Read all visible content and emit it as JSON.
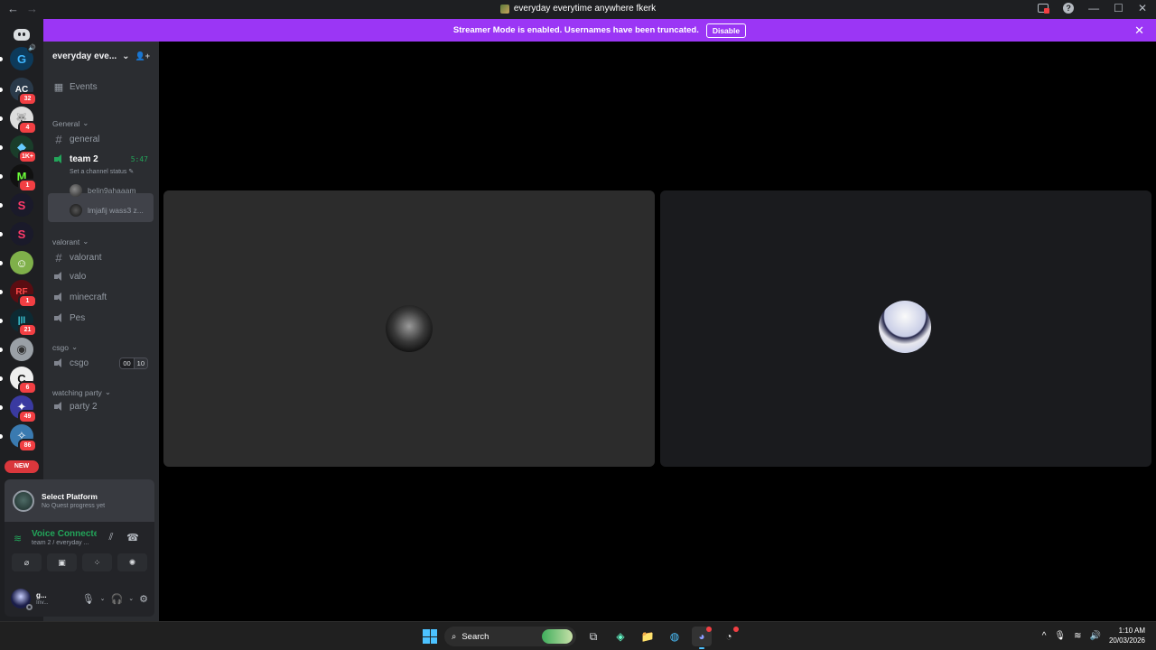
{
  "window": {
    "title": "everyday everytime anywhere fkerk",
    "back_glyph": "←",
    "forward_glyph": "→",
    "help_glyph": "?",
    "minimize_glyph": "—",
    "maximize_glyph": "☐",
    "close_glyph": "✕"
  },
  "banner": {
    "text": "Streamer Mode is enabled. Usernames have been truncated.",
    "button": "Disable",
    "close_glyph": "✕",
    "color": "#9b36f5"
  },
  "guilds": [
    {
      "name": "guild-g",
      "letter": "G",
      "bg": "#0d3a5a",
      "fg": "#3fb6ff",
      "badge": null,
      "speaker": true
    },
    {
      "name": "guild-ac",
      "letter": "AC",
      "bg": "#2a3a4a",
      "fg": "#fff",
      "badge": "32",
      "speaker": false
    },
    {
      "name": "guild-wolf",
      "letter": "🐺",
      "bg": "#ddd",
      "fg": "#222",
      "badge": "4",
      "speaker": false
    },
    {
      "name": "guild-dark",
      "letter": "◆",
      "bg": "#1a3d2a",
      "fg": "#6cf",
      "badge": "1K+",
      "speaker": false
    },
    {
      "name": "guild-m",
      "letter": "M",
      "bg": "#111",
      "fg": "#6cff3a",
      "badge": "1",
      "speaker": false
    },
    {
      "name": "guild-s1",
      "letter": "S",
      "bg": "#1a1a2a",
      "fg": "#ff3a6a",
      "badge": null,
      "speaker": false
    },
    {
      "name": "guild-s2",
      "letter": "S",
      "bg": "#1a1a2a",
      "fg": "#ff3a6a",
      "badge": null,
      "speaker": false
    },
    {
      "name": "guild-face",
      "letter": "☺",
      "bg": "#7fb04a",
      "fg": "#fff",
      "badge": null,
      "speaker": false
    },
    {
      "name": "guild-red",
      "letter": "RF",
      "bg": "#5a0d12",
      "fg": "#ff4a4a",
      "badge": "1",
      "speaker": false
    },
    {
      "name": "guild-teal",
      "letter": "|||",
      "bg": "#0d2a33",
      "fg": "#3fd6e6",
      "badge": "21",
      "speaker": false
    },
    {
      "name": "guild-gray",
      "letter": "◉",
      "bg": "#9aa0a6",
      "fg": "#333",
      "badge": null,
      "speaker": false
    },
    {
      "name": "guild-white",
      "letter": "C",
      "bg": "#eee",
      "fg": "#111",
      "badge": "6",
      "speaker": false
    },
    {
      "name": "guild-anime",
      "letter": "✦",
      "bg": "#3a3aa0",
      "fg": "#fff",
      "badge": "49",
      "speaker": false
    },
    {
      "name": "guild-blue",
      "letter": "✧",
      "bg": "#3a7ab0",
      "fg": "#fff",
      "badge": "86",
      "speaker": false
    }
  ],
  "new_badge": "NEW",
  "server": {
    "name": "everyday eve...",
    "chevron": "⌄",
    "invite_glyph": "👤+",
    "events_label": "Events",
    "categories": [
      {
        "label": "General",
        "chevron": "⌄"
      },
      {
        "label": "valorant",
        "chevron": "⌄"
      },
      {
        "label": "csgo",
        "chevron": "⌄"
      },
      {
        "label": "watching party",
        "chevron": "⌄"
      }
    ],
    "channels": {
      "general": "general",
      "team2": "team 2",
      "team2_time": "5:47",
      "team2_status": "Set a channel status ✎",
      "valorant": "valorant",
      "valo": "valo",
      "minecraft": "minecraft",
      "pes": "Pes",
      "csgo": "csgo",
      "csgo_count": "00",
      "csgo_limit": "10",
      "party2": "party 2"
    },
    "members": [
      "belin9ahaaam",
      "lmjafij wass3 z..."
    ]
  },
  "quest": {
    "title": "Select Platform",
    "subtitle": "No Quest progress yet"
  },
  "voice": {
    "status": "Voice Connected",
    "channel": "team 2 / everyday ...",
    "noise_glyph": "⫽",
    "disconnect_glyph": "☎",
    "signal_glyph": "≋"
  },
  "voice_actions": [
    "⌀",
    "▣",
    "⁘",
    "✺"
  ],
  "user": {
    "name": "g...",
    "status": "Inv...",
    "mic_glyph": "🎙",
    "headset_glyph": "🎧",
    "caret_glyph": "⌄",
    "settings_glyph": "⚙"
  },
  "taskbar": {
    "search": "Search",
    "search_glyph": "⌕",
    "apps": [
      {
        "name": "task-view",
        "glyph": "⧉",
        "active": false
      },
      {
        "name": "copilot",
        "glyph": "◈",
        "active": false
      },
      {
        "name": "file-explorer",
        "glyph": "📁",
        "active": false
      },
      {
        "name": "browser",
        "glyph": "◍",
        "active": false
      },
      {
        "name": "discord",
        "glyph": "◕",
        "active": true
      },
      {
        "name": "chromium",
        "glyph": "◔",
        "active": false
      }
    ],
    "tray_up": "^",
    "mic": "🎙",
    "wifi": "≋",
    "volume": "🔊",
    "time": "1:10 AM",
    "date": "20/03/2026"
  }
}
